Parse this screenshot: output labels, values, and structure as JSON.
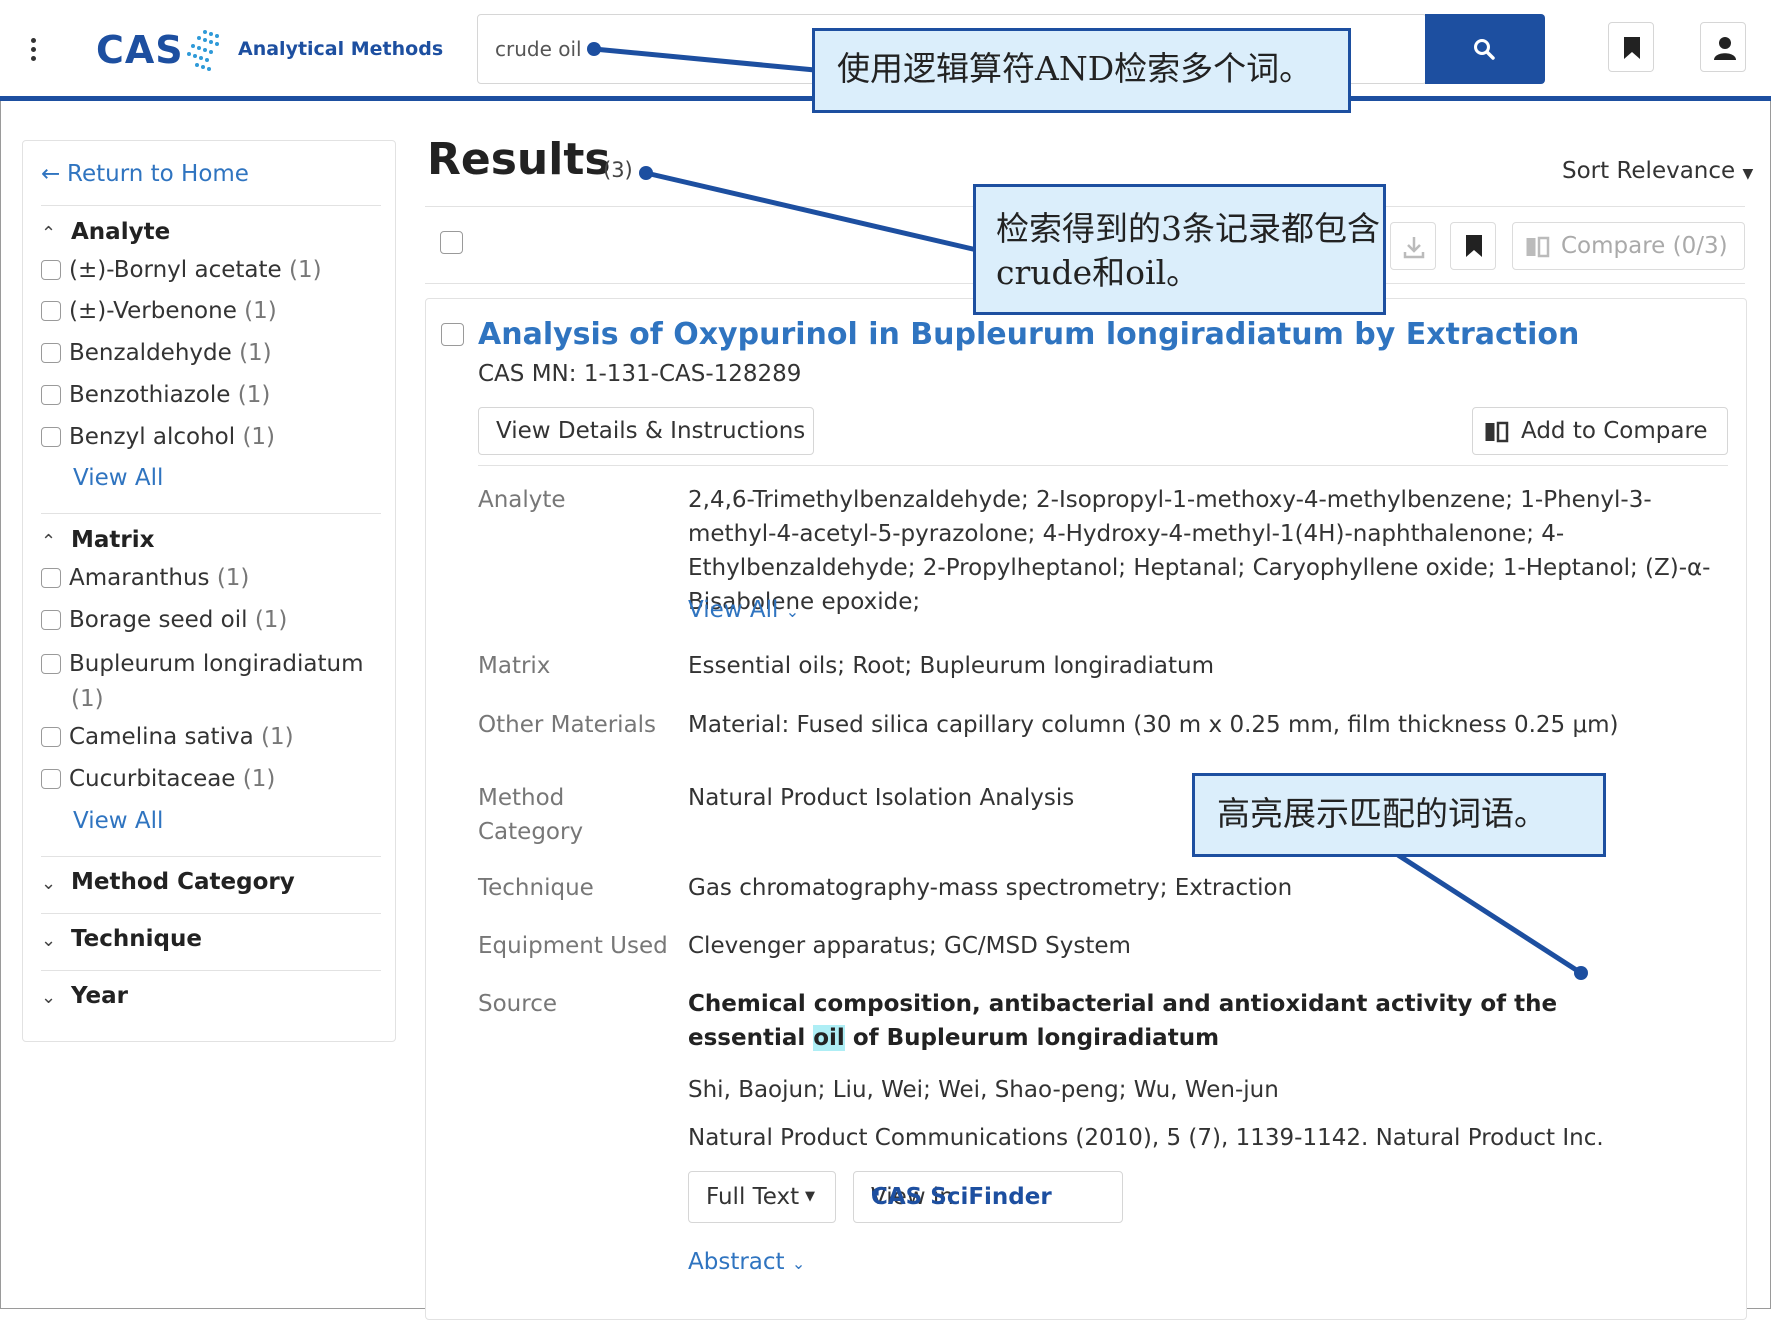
{
  "header": {
    "brand": "CAS",
    "product": "Analytical Methods",
    "search_value": "crude oil"
  },
  "sidebar": {
    "return_label": "Return to Home",
    "facets": {
      "analyte": {
        "title": "Analyte",
        "items": [
          {
            "label": "(±)-Bornyl acetate",
            "count": "(1)"
          },
          {
            "label": "(±)-Verbenone",
            "count": "(1)"
          },
          {
            "label": "Benzaldehyde",
            "count": "(1)"
          },
          {
            "label": "Benzothiazole",
            "count": "(1)"
          },
          {
            "label": "Benzyl alcohol",
            "count": "(1)"
          }
        ],
        "view_all": "View All"
      },
      "matrix": {
        "title": "Matrix",
        "items": [
          {
            "label": "Amaranthus",
            "count": "(1)"
          },
          {
            "label": "Borage seed oil",
            "count": "(1)"
          },
          {
            "label": "Bupleurum longiradiatum",
            "count": "(1)"
          },
          {
            "label": "Camelina sativa",
            "count": "(1)"
          },
          {
            "label": "Cucurbitaceae",
            "count": "(1)"
          }
        ],
        "view_all": "View All"
      },
      "collapsed": [
        "Method Category",
        "Technique",
        "Year"
      ]
    }
  },
  "results": {
    "title": "Results",
    "count": "(3)",
    "sort_label": "Sort Relevance",
    "compare_label": "Compare (0/3)"
  },
  "result": {
    "title": "Analysis of Oxypurinol in Bupleurum longiradiatum by Extraction",
    "cas_mn": "CAS MN: 1-131-CAS-128289",
    "view_details": "View Details & Instructions",
    "add_compare": "Add to Compare",
    "fields": {
      "analyte_label": "Analyte",
      "analyte_value": "2,4,6-Trimethylbenzaldehyde; 2-Isopropyl-1-methoxy-4-methylbenzene; 1-Phenyl-3-methyl-4-acetyl-5-pyrazolone; 4-Hydroxy-4-methyl-1(4H)-naphthalenone; 4-Ethylbenzaldehyde; 2-Propylheptanol; Heptanal; Caryophyllene oxide; 1-Heptanol; (Z)-α-Bisabolene epoxide;",
      "analyte_view_all": "View All",
      "matrix_label": "Matrix",
      "matrix_value": "Essential oils; Root; Bupleurum longiradiatum",
      "other_label": "Other Materials",
      "other_value": "Material: Fused silica capillary column (30 m x 0.25 mm, film thickness 0.25 μm)",
      "method_label": "Method Category",
      "method_value": "Natural Product Isolation Analysis",
      "technique_label": "Technique",
      "technique_value": "Gas chromatography-mass spectrometry; Extraction",
      "equipment_label": "Equipment Used",
      "equipment_value": "Clevenger apparatus; GC/MSD System",
      "source_label": "Source",
      "source_title_before": "Chemical composition, antibacterial and antioxidant activity of the essential ",
      "source_title_highlight": "oil",
      "source_title_after": " of Bupleurum longiradiatum",
      "source_authors": "Shi, Baojun; Liu, Wei; Wei, Shao-peng; Wu, Wen-jun",
      "source_journal": "Natural Product Communications (2010), 5 (7), 1139-1142. Natural Product Inc."
    },
    "full_text": "Full Text",
    "view_in": "View in",
    "scifinder": "CAS SciFinder",
    "scifinder_sup": "n",
    "abstract": "Abstract"
  },
  "annotations": {
    "callout_search": "使用逻辑算符AND检索多个词。",
    "callout_results": "检索得到的3条记录都包含crude和oil。",
    "callout_highlight": "高亮展示匹配的词语。",
    "accent_color": "#1d4fa0",
    "callout_fill": "#dbeefb",
    "highlight_color": "#aeeef5"
  }
}
